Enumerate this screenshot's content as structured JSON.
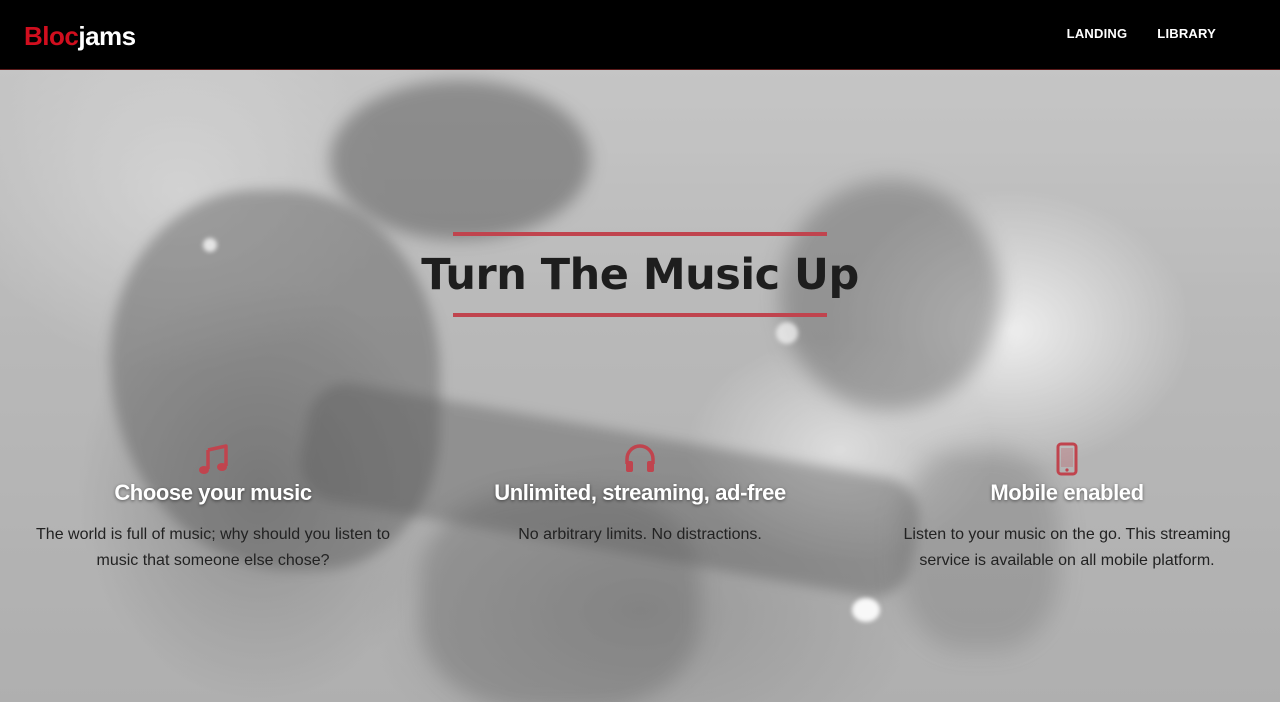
{
  "navbar": {
    "logo": {
      "part1": "Bloc",
      "part2": "jams"
    },
    "links": [
      {
        "label": "LANDING"
      },
      {
        "label": "LIBRARY"
      }
    ]
  },
  "hero": {
    "title": "Turn The Music Up",
    "accent_color": "#c0444e"
  },
  "features": [
    {
      "icon": "music-note-icon",
      "title": "Choose your music",
      "description": "The world is full of music; why should you listen to music that someone else chose?"
    },
    {
      "icon": "headphones-icon",
      "title": "Unlimited, streaming, ad-free",
      "description": "No arbitrary limits. No distractions."
    },
    {
      "icon": "mobile-phone-icon",
      "title": "Mobile enabled",
      "description": "Listen to your music on the go. This streaming service is available on all mobile platform."
    }
  ]
}
